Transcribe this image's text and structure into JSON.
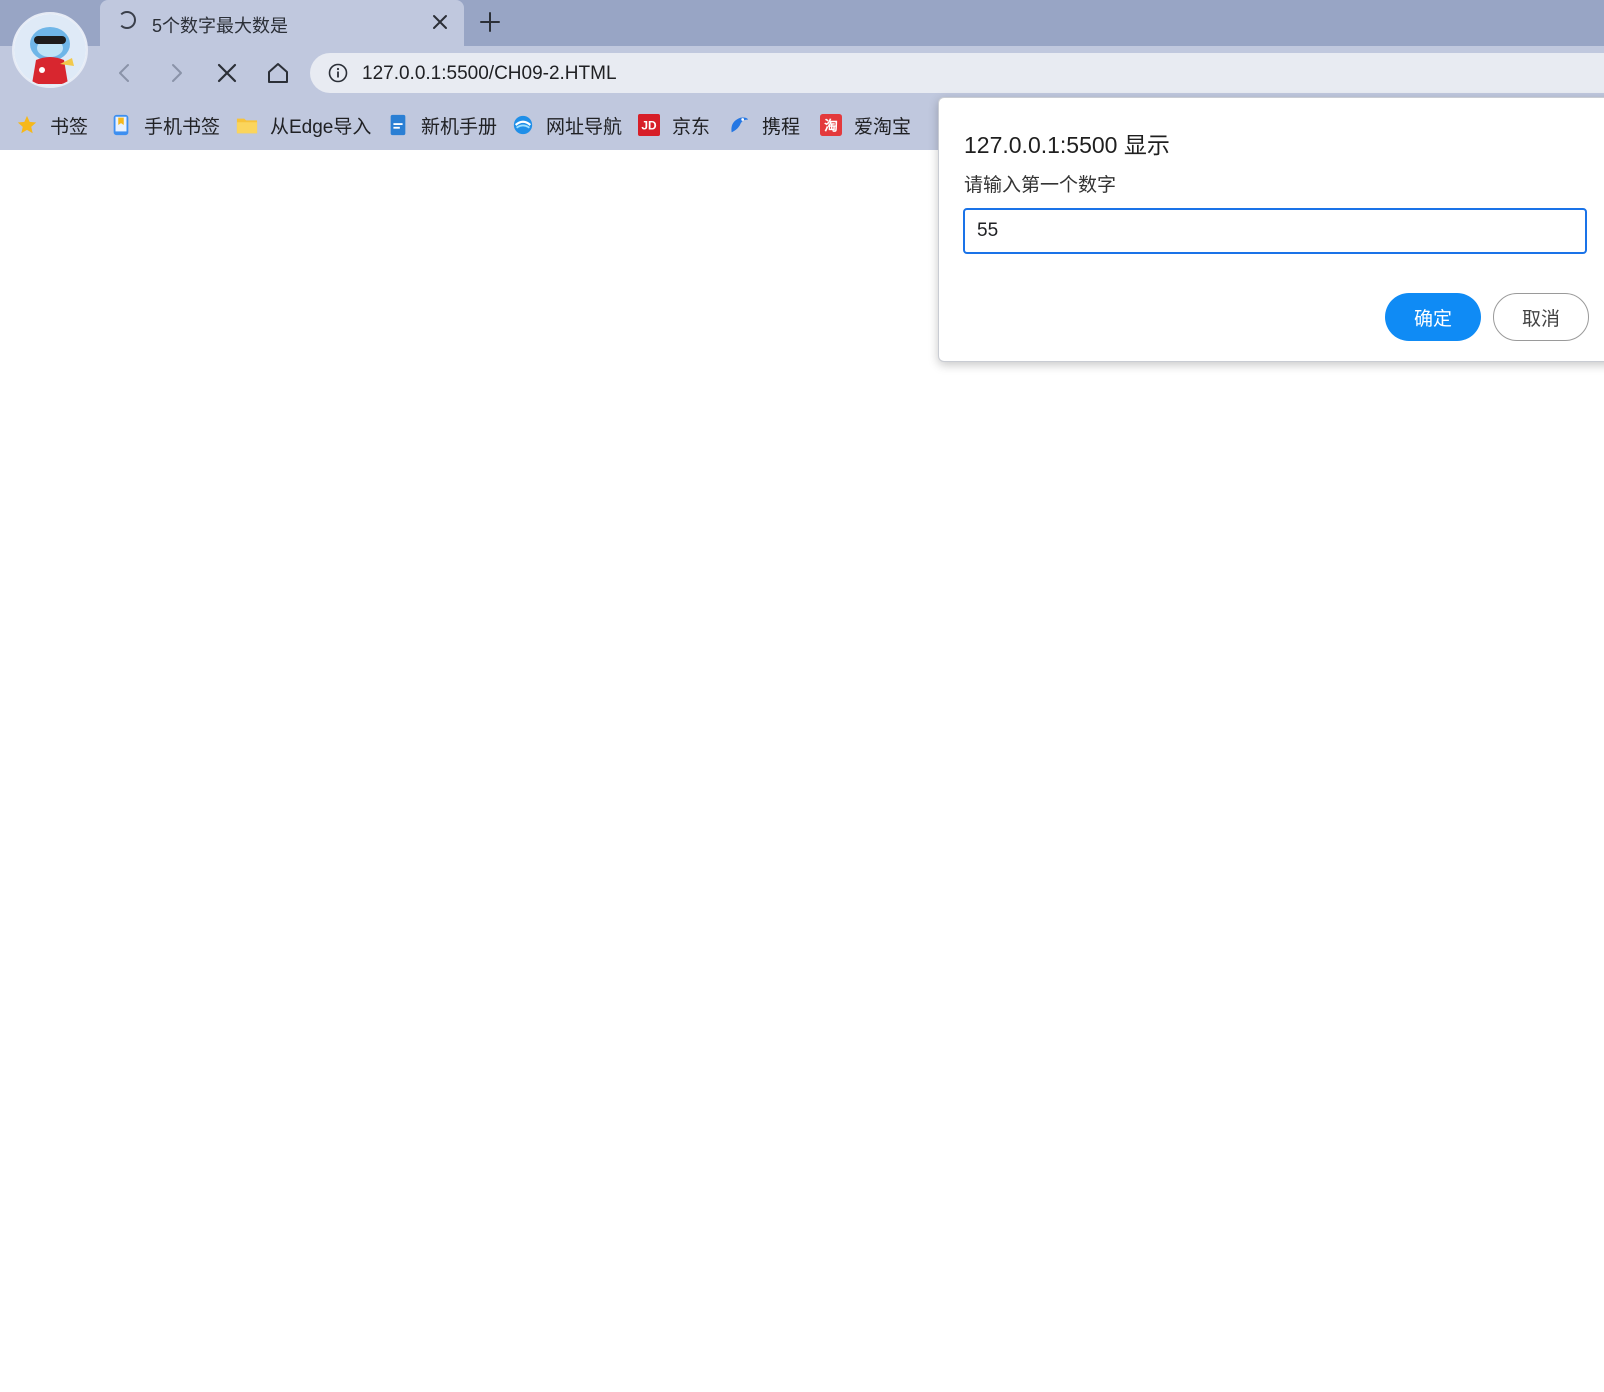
{
  "tab": {
    "title": "5个数字最大数是"
  },
  "address_bar": {
    "url": "127.0.0.1:5500/CH09-2.HTML"
  },
  "bookmarks": [
    {
      "label": "书签",
      "icon": "star-icon"
    },
    {
      "label": "手机书签",
      "icon": "phone-bookmark-icon"
    },
    {
      "label": "从Edge导入",
      "icon": "folder-icon"
    },
    {
      "label": "新机手册",
      "icon": "manual-icon"
    },
    {
      "label": "网址导航",
      "icon": "nav-globe-icon"
    },
    {
      "label": "京东",
      "icon": "jd-logo-icon"
    },
    {
      "label": "携程",
      "icon": "ctrip-logo-icon"
    },
    {
      "label": "爱淘宝",
      "icon": "taobao-logo-icon"
    }
  ],
  "bookmark_logo_text": {
    "jd": "JD",
    "taobao": "淘"
  },
  "dialog": {
    "title": "127.0.0.1:5500 显示",
    "message": "请输入第一个数字",
    "input_value": "55",
    "ok_label": "确定",
    "cancel_label": "取消"
  },
  "colors": {
    "tabstrip": "#98a5c5",
    "toolbar": "#c0c8de",
    "accent": "#0f8bf5",
    "input_focus": "#1a73e8"
  }
}
